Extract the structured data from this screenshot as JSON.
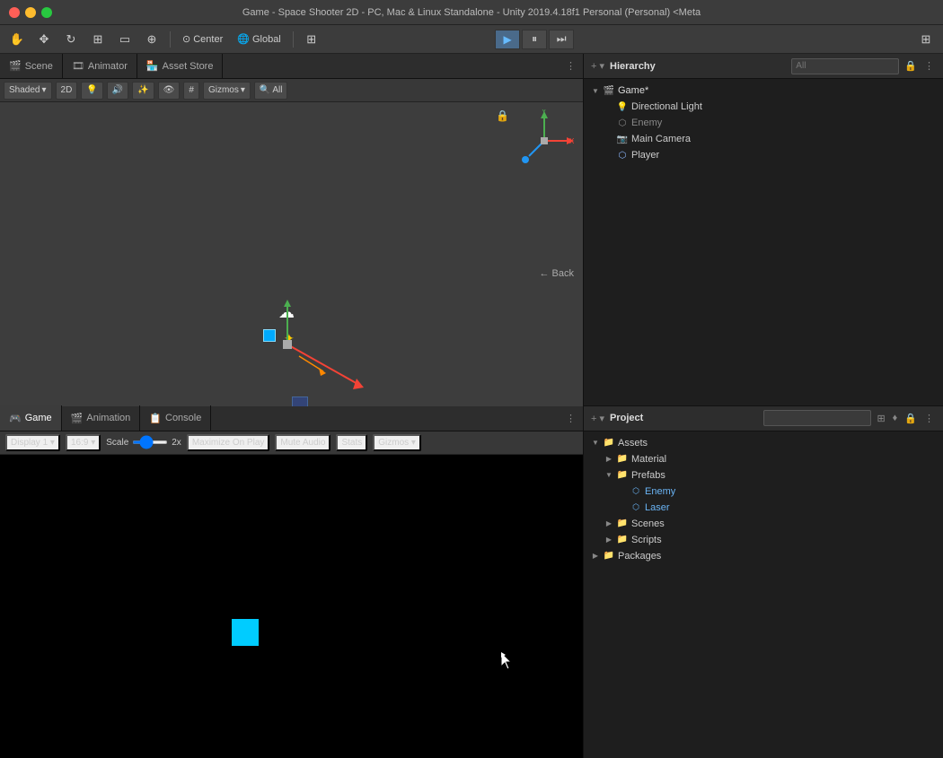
{
  "titlebar": {
    "title": "Game - Space Shooter 2D - PC, Mac & Linux Standalone - Unity 2019.4.18f1 Personal (Personal) <Meta"
  },
  "toolbar": {
    "tools": [
      "hand",
      "move",
      "rotate",
      "scale",
      "rect",
      "transform"
    ],
    "pivot": "Center",
    "space": "Global",
    "layers": "Layers"
  },
  "play_controls": {
    "play_label": "▶",
    "pause_label": "⏸",
    "step_label": "⏭"
  },
  "scene_tab": {
    "tabs": [
      {
        "label": "Scene",
        "icon": "🎬",
        "active": false
      },
      {
        "label": "Animator",
        "icon": "🎞",
        "active": false
      },
      {
        "label": "Asset Store",
        "icon": "🏪",
        "active": false
      }
    ],
    "shading": "Shaded",
    "mode_2d": "2D",
    "gizmos": "Gizmos",
    "all": "All"
  },
  "game_tab": {
    "tabs": [
      {
        "label": "Game",
        "icon": "🎮",
        "active": true
      },
      {
        "label": "Animation",
        "icon": "🎬",
        "active": false
      },
      {
        "label": "Console",
        "icon": "📋",
        "active": false
      }
    ],
    "display": "Display 1",
    "aspect": "16:9",
    "scale_label": "Scale",
    "scale_value": "2x",
    "maximize_on_play": "Maximize On Play",
    "mute_audio": "Mute Audio",
    "stats": "Stats",
    "gizmos": "Gizmos"
  },
  "hierarchy": {
    "title": "Hierarchy",
    "search_placeholder": "All",
    "items": [
      {
        "label": "Game*",
        "level": 0,
        "has_children": true,
        "icon": "scene"
      },
      {
        "label": "Directional Light",
        "level": 1,
        "has_children": false,
        "icon": "light"
      },
      {
        "label": "Enemy",
        "level": 1,
        "has_children": false,
        "icon": "obj",
        "dimmed": true
      },
      {
        "label": "Main Camera",
        "level": 1,
        "has_children": false,
        "icon": "camera"
      },
      {
        "label": "Player",
        "level": 1,
        "has_children": false,
        "icon": "obj"
      }
    ]
  },
  "project": {
    "title": "Project",
    "search_placeholder": "",
    "tree": [
      {
        "label": "Assets",
        "level": 0,
        "type": "folder",
        "expanded": true
      },
      {
        "label": "Material",
        "level": 1,
        "type": "folder",
        "expanded": false
      },
      {
        "label": "Prefabs",
        "level": 1,
        "type": "folder",
        "expanded": true
      },
      {
        "label": "Enemy",
        "level": 2,
        "type": "prefab"
      },
      {
        "label": "Laser",
        "level": 2,
        "type": "prefab"
      },
      {
        "label": "Scenes",
        "level": 1,
        "type": "folder",
        "expanded": false
      },
      {
        "label": "Scripts",
        "level": 1,
        "type": "folder",
        "expanded": false
      },
      {
        "label": "Packages",
        "level": 0,
        "type": "folder",
        "expanded": false
      }
    ]
  },
  "colors": {
    "accent_blue": "#00ccff",
    "enemy_color": "#aaa",
    "selected_bg": "#2a4a6a"
  }
}
